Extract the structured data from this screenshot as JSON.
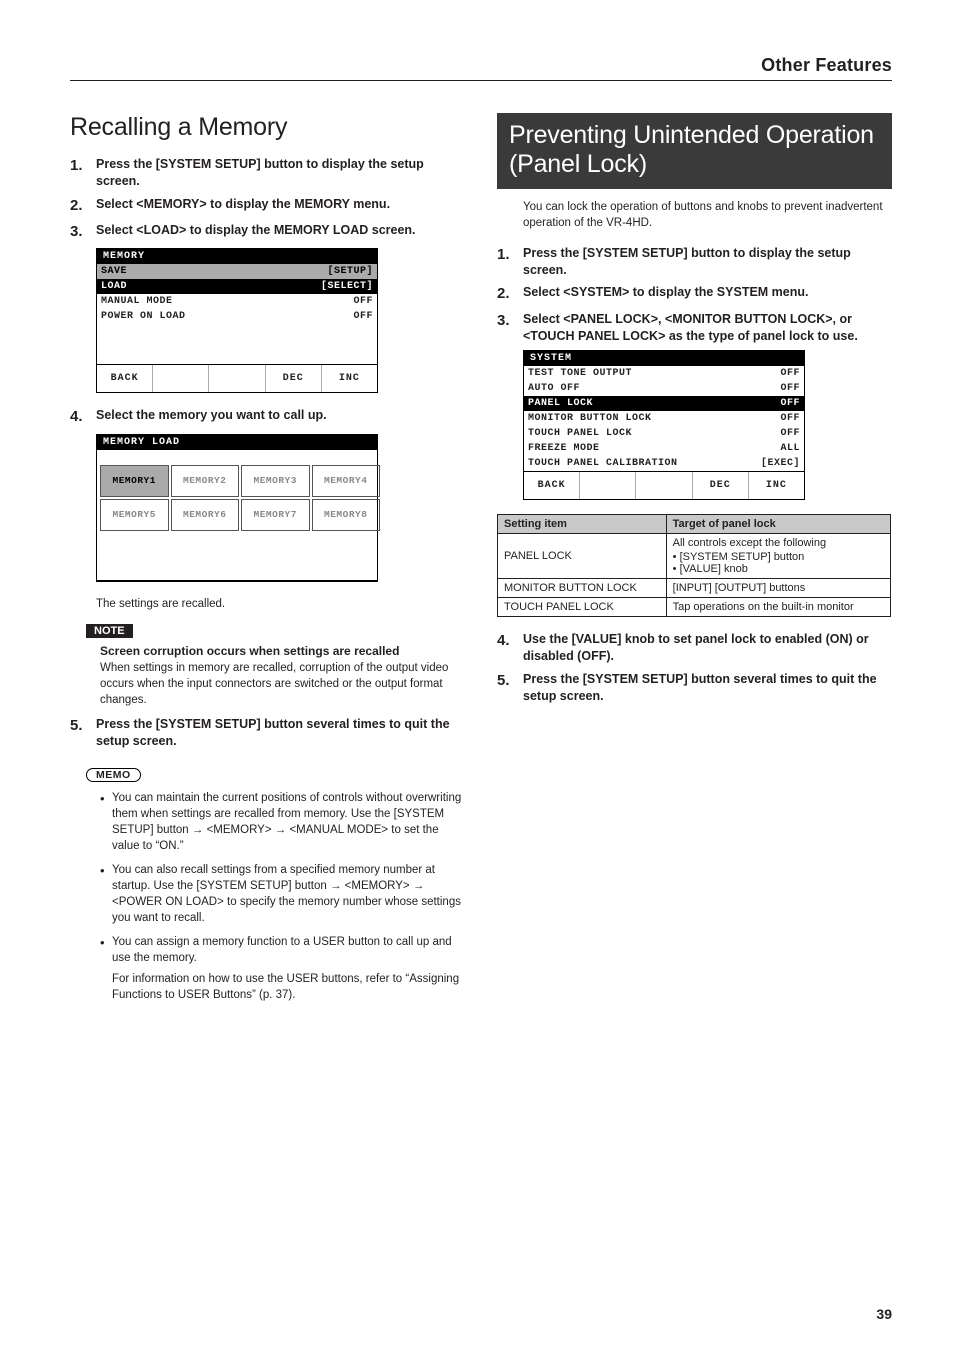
{
  "header": {
    "title": "Other Features"
  },
  "left": {
    "heading": "Recalling a Memory",
    "steps": {
      "s1": "Press the [SYSTEM SETUP] button to display the setup screen.",
      "s2": "Select <MEMORY> to display the MEMORY menu.",
      "s3": "Select <LOAD> to display the MEMORY LOAD screen.",
      "s4": "Select the memory you want to call up.",
      "s5": "Press the [SYSTEM SETUP] button several times to quit the setup screen."
    },
    "screen1": {
      "title": "MEMORY",
      "rows": [
        {
          "label": "SAVE",
          "value": "[SETUP]"
        },
        {
          "label": "LOAD",
          "value": "[SELECT]"
        },
        {
          "label": "MANUAL MODE",
          "value": "OFF"
        },
        {
          "label": "POWER ON LOAD",
          "value": "OFF"
        }
      ],
      "footer": [
        "BACK",
        "",
        "",
        "DEC",
        "INC"
      ]
    },
    "screen2": {
      "title": "MEMORY LOAD",
      "cells": [
        "MEMORY1",
        "MEMORY2",
        "MEMORY3",
        "MEMORY4",
        "MEMORY5",
        "MEMORY6",
        "MEMORY7",
        "MEMORY8"
      ]
    },
    "recalled": "The settings are recalled.",
    "note_label": "NOTE",
    "note_title": "Screen corruption occurs when settings are recalled",
    "note_body": "When settings in memory are recalled, corruption of the output video occurs when the input connectors are switched or the output format changes.",
    "memo_label": "MEMO",
    "memo": {
      "b1": "You can maintain the current positions of controls without overwriting them when settings are recalled from memory. Use the [SYSTEM SETUP] button → <MEMORY> → <MANUAL MODE> to set the value to “ON.”",
      "b2": "You can also recall settings from a specified memory number at startup. Use the [SYSTEM SETUP] button → <MEMORY> → <POWER ON LOAD> to specify the memory number whose settings you want to recall.",
      "b3": "You can assign a memory function to a USER button to call up and use the memory.",
      "b3b": "For information on how to use the USER buttons, refer to “Assigning Functions to USER Buttons” (p. 37)."
    }
  },
  "right": {
    "heading": "Preventing Unintended Operation (Panel Lock)",
    "intro": "You can lock the operation of buttons and knobs to prevent inadvertent operation of the VR-4HD.",
    "steps": {
      "s1": "Press the [SYSTEM SETUP] button to display the setup screen.",
      "s2": "Select <SYSTEM> to display the SYSTEM menu.",
      "s3": "Select <PANEL LOCK>, <MONITOR BUTTON LOCK>, or <TOUCH PANEL LOCK> as the type of panel lock to use.",
      "s4": "Use the [VALUE] knob to set panel lock to enabled (ON) or disabled (OFF).",
      "s5": "Press the [SYSTEM SETUP] button several times to quit the setup screen."
    },
    "screen": {
      "title": "SYSTEM",
      "rows": [
        {
          "label": "TEST TONE OUTPUT",
          "value": "OFF"
        },
        {
          "label": "AUTO OFF",
          "value": "OFF"
        },
        {
          "label": "PANEL LOCK",
          "value": "OFF"
        },
        {
          "label": "MONITOR BUTTON LOCK",
          "value": "OFF"
        },
        {
          "label": "TOUCH PANEL LOCK",
          "value": "OFF"
        },
        {
          "label": "FREEZE MODE",
          "value": "ALL"
        },
        {
          "label": "TOUCH PANEL CALIBRATION",
          "value": "[EXEC]"
        }
      ],
      "footer": [
        "BACK",
        "",
        "",
        "DEC",
        "INC"
      ]
    },
    "table": {
      "h1": "Setting item",
      "h2": "Target of panel lock",
      "r1c1": "PANEL LOCK",
      "r1c2": "All controls except the following",
      "r1b1": "[SYSTEM SETUP] button",
      "r1b2": "[VALUE] knob",
      "r2c1": "MONITOR BUTTON LOCK",
      "r2c2": "[INPUT] [OUTPUT] buttons",
      "r3c1": "TOUCH PANEL LOCK",
      "r3c2": "Tap operations on the built-in monitor"
    }
  },
  "pagenum": "39"
}
